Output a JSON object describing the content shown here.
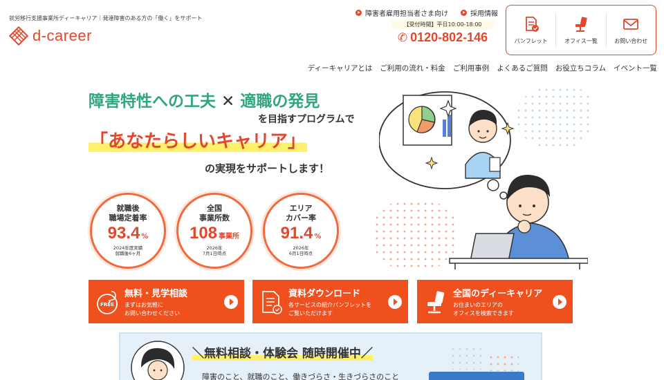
{
  "header": {
    "tagline": "就労移行支援事業所ディーキャリア｜発達障害のある方の「働く」をサポート",
    "logo_text": "d-career",
    "top_links": [
      {
        "label": "障害者雇用担当者さま向け"
      },
      {
        "label": "採用情報"
      }
    ],
    "phone": {
      "hours": "【受付時間】平日10:00-18:00",
      "number": "0120-802-146"
    },
    "actions": [
      {
        "label": "パンフレット",
        "icon": "pamphlet-icon"
      },
      {
        "label": "オフィス一覧",
        "icon": "office-chair-icon"
      },
      {
        "label": "お問い合わせ",
        "icon": "mail-icon"
      }
    ]
  },
  "nav": [
    "ディーキャリアとは",
    "ご利用の流れ・料金",
    "ご利用事例",
    "よくあるご質問",
    "お役立ちコラム",
    "イベント一覧"
  ],
  "hero": {
    "line1_a": "障害特性への工夫",
    "line1_x": "✕",
    "line1_b": "適職の発見",
    "line2": "を目指すプログラムで",
    "line3": "「あなたらしいキャリア」",
    "line4": "の実現をサポートします！"
  },
  "stats": [
    {
      "title1": "就職後",
      "title2": "職場定着率",
      "value": "93.4",
      "unit": "%",
      "note1": "2024年度実績",
      "note2": "就職後6ヶ月"
    },
    {
      "title1": "全国",
      "title2": "事業所数",
      "value": "108",
      "unit": "事業所",
      "note1": "2026年",
      "note2": "7月1日時点"
    },
    {
      "title1": "エリア",
      "title2": "カバー率",
      "value": "91.4",
      "unit": "%",
      "note1": "2026年",
      "note2": "6月1日時点"
    }
  ],
  "ctas": [
    {
      "title": "無料・見学相談",
      "sub1": "まずはお気軽に",
      "sub2": "お問い合わせください",
      "icon": "free-consultation-icon",
      "badge": "FREE"
    },
    {
      "title": "資料ダウンロード",
      "sub1": "各サービスの紹介パンフレットを",
      "sub2": "ご覧いただけます",
      "icon": "document-icon"
    },
    {
      "title": "全国のディーキャリア",
      "sub1": "お住まいのエリアの",
      "sub2": "オフィスを検索できます",
      "icon": "office-chair-icon"
    }
  ],
  "banner": {
    "title": "＼無料相談・体験会 随時開催中／",
    "sub": "障害のこと、就職のこと、働きづらさ・生きづらさのこと"
  },
  "colors": {
    "brand": "#e2472b",
    "cta": "#f0501e",
    "green": "#2ea77d",
    "highlight": "#fff06b"
  }
}
